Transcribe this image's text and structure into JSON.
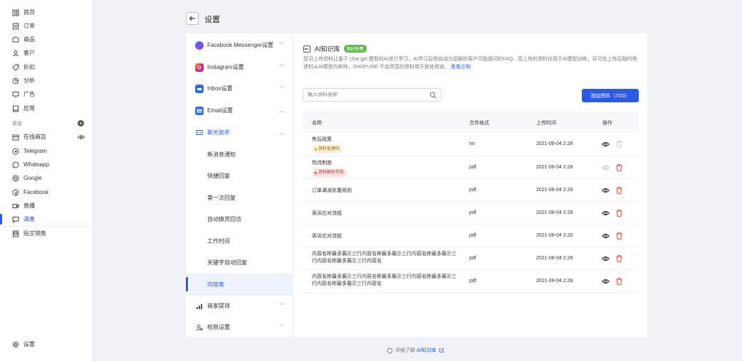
{
  "sidebar": {
    "items": [
      {
        "label": "首页",
        "icon": "dashboard-icon"
      },
      {
        "label": "订单",
        "icon": "order-icon"
      },
      {
        "label": "商品",
        "icon": "product-icon"
      },
      {
        "label": "客户",
        "icon": "customer-icon"
      },
      {
        "label": "折扣",
        "icon": "discount-icon"
      },
      {
        "label": "分析",
        "icon": "analytics-icon"
      },
      {
        "label": "广告",
        "icon": "ads-icon"
      },
      {
        "label": "应用",
        "icon": "apps-icon"
      }
    ],
    "section_label": "渠道",
    "channels": [
      {
        "label": "在线商店",
        "icon": "store-icon"
      },
      {
        "label": "Telegram",
        "icon": "telegram-icon"
      },
      {
        "label": "Whatsapp",
        "icon": "whatsapp-icon"
      },
      {
        "label": "Google",
        "icon": "google-icon"
      },
      {
        "label": "Facebook",
        "icon": "facebook-icon"
      },
      {
        "label": "直播",
        "icon": "live-icon"
      },
      {
        "label": "消息",
        "icon": "message-icon"
      },
      {
        "label": "贴文销售",
        "icon": "post-sales-icon"
      }
    ],
    "settings_label": "设置"
  },
  "header": {
    "title": "设置"
  },
  "menu": {
    "groups": [
      {
        "label": "Facebook Messenger设置",
        "icon": "messenger-icon"
      },
      {
        "label": "Instagram设置",
        "icon": "instagram-icon"
      },
      {
        "label": "Inbox设置",
        "icon": "inbox-icon"
      },
      {
        "label": "Email设置",
        "icon": "email-icon"
      },
      {
        "label": "聊天助手",
        "icon": "chat-assistant-icon"
      }
    ],
    "subitems": [
      "新消息通知",
      "快捷回复",
      "第一次回复",
      "自动换货回访",
      "工作时间",
      "关键字自动回复",
      "内容库"
    ],
    "after": [
      {
        "label": "商家提效",
        "icon": "efficiency-icon"
      },
      {
        "label": "权限设置",
        "icon": "permission-icon"
      }
    ]
  },
  "kb": {
    "title": "AI知识库",
    "badge": "限时免费",
    "description": "您可上传资料让基于 chat gpt 模型的AI进行学习，AI学习后将自动为您解析客户可能提问的FAQ。您上传的资料仅用于AI模型训练，并可在上传后随时将资料从AI模型内移除，SHOPLINE 不会将您的资料用于其他用途。",
    "example_link": "查看示例",
    "search_placeholder": "输入资料名称",
    "add_button": "添加资料（7/20）"
  },
  "table": {
    "headers": {
      "name": "名称",
      "format": "文件格式",
      "time": "上传时间",
      "action": "操作"
    },
    "rows": [
      {
        "name": "售后政策",
        "tag": "资料处理中",
        "tag_type": "warn",
        "format": "txt",
        "time": "2021-08-04 2:28",
        "view_disabled": false,
        "delete_disabled": true
      },
      {
        "name": "物流制度",
        "tag": "资料解析失败",
        "tag_type": "err",
        "format": "pdf",
        "time": "2021-08-04 2:28",
        "view_disabled": true,
        "delete_disabled": false
      },
      {
        "name": "订单满减优惠规则",
        "tag": "",
        "tag_type": "",
        "format": "pdf",
        "time": "2021-08-04 2:28",
        "view_disabled": false,
        "delete_disabled": false
      },
      {
        "name": "客诉应对流程",
        "tag": "",
        "tag_type": "",
        "format": "pdf",
        "time": "2021-08-04 2:28",
        "view_disabled": false,
        "delete_disabled": false
      },
      {
        "name": "客诉应对流程",
        "tag": "",
        "tag_type": "",
        "format": "pdf",
        "time": "2021-08-04 2:28",
        "view_disabled": false,
        "delete_disabled": false
      },
      {
        "name": "内容名称最多展示三行内容名称最多展示三行内容名称最多展示三行内容名称最多展示三行内容名",
        "tag": "",
        "tag_type": "",
        "format": "pdf",
        "time": "2021-08-04 2:28",
        "view_disabled": false,
        "delete_disabled": false
      },
      {
        "name": "内容名称最多展示三行内容名称最多展示三行内容名称最多展示三行内容名称最多展示三行内容名",
        "tag": "",
        "tag_type": "",
        "format": "pdf",
        "time": "2021-08-04 2:28",
        "view_disabled": false,
        "delete_disabled": false
      }
    ]
  },
  "footer": {
    "prefix": "详细了解",
    "link": "AI知识库"
  },
  "colors": {
    "accent": "#2b5be6",
    "danger": "#e0443a",
    "success": "#5fba47"
  }
}
